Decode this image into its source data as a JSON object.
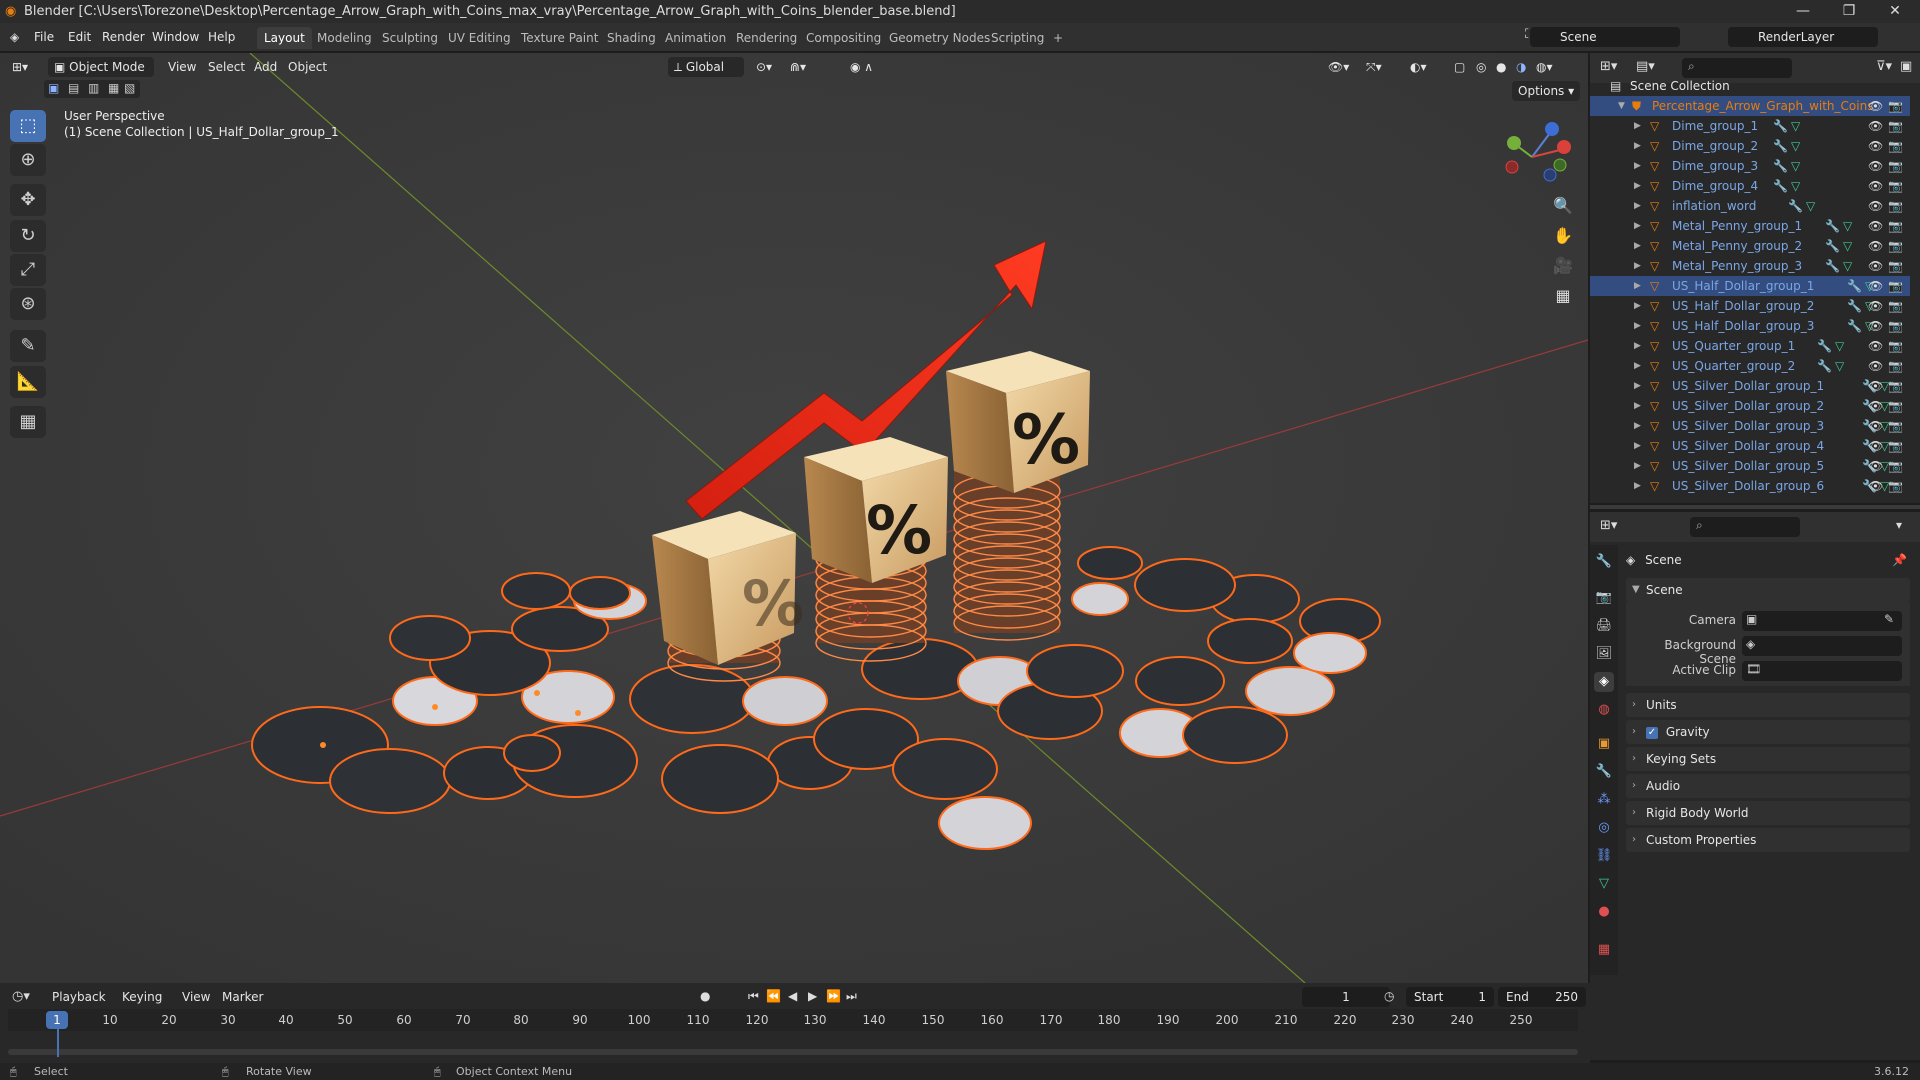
{
  "window": {
    "title": "Blender [C:\\Users\\Torezone\\Desktop\\Percentage_Arrow_Graph_with_Coins_max_vray\\Percentage_Arrow_Graph_with_Coins_blender_base.blend]"
  },
  "menu": [
    "File",
    "Edit",
    "Render",
    "Window",
    "Help"
  ],
  "workspaces": [
    "Layout",
    "Modeling",
    "Sculpting",
    "UV Editing",
    "Texture Paint",
    "Shading",
    "Animation",
    "Rendering",
    "Compositing",
    "Geometry Nodes",
    "Scripting",
    "+"
  ],
  "active_workspace": "Layout",
  "scene_field": "Scene",
  "renderlayer_field": "RenderLayer",
  "viewport": {
    "mode": "Object Mode",
    "menus": [
      "View",
      "Select",
      "Add",
      "Object"
    ],
    "orientation": "Global",
    "options": "Options",
    "overlay_title": "User Perspective",
    "overlay_context": "(1) Scene Collection | US_Half_Dollar_group_1",
    "gizmo": {
      "x": "X",
      "y": "Y",
      "z": "Z"
    }
  },
  "outliner": {
    "root": "Scene Collection",
    "collection": "Percentage_Arrow_Graph_with_Coins",
    "items": [
      "Dime_group_1",
      "Dime_group_2",
      "Dime_group_3",
      "Dime_group_4",
      "inflation_word",
      "Metal_Penny_group_1",
      "Metal_Penny_group_2",
      "Metal_Penny_group_3",
      "US_Half_Dollar_group_1",
      "US_Half_Dollar_group_2",
      "US_Half_Dollar_group_3",
      "US_Quarter_group_1",
      "US_Quarter_group_2",
      "US_Silver_Dollar_group_1",
      "US_Silver_Dollar_group_2",
      "US_Silver_Dollar_group_3",
      "US_Silver_Dollar_group_4",
      "US_Silver_Dollar_group_5",
      "US_Silver_Dollar_group_6"
    ],
    "selected": "US_Half_Dollar_group_1"
  },
  "properties": {
    "header": "Scene",
    "section": "Scene",
    "labels": {
      "camera": "Camera",
      "background_scene": "Background Scene",
      "active_clip": "Active Clip"
    },
    "panels": [
      "Units",
      "Gravity",
      "Keying Sets",
      "Audio",
      "Rigid Body World",
      "Custom Properties"
    ],
    "gravity_checked": true
  },
  "timeline": {
    "menus": [
      "Playback",
      "Keying",
      "View",
      "Marker"
    ],
    "current_frame": "1",
    "start_label": "Start",
    "start": "1",
    "end_label": "End",
    "end": "250",
    "ticks": [
      "1",
      "10",
      "20",
      "30",
      "40",
      "50",
      "60",
      "70",
      "80",
      "90",
      "100",
      "110",
      "120",
      "130",
      "140",
      "150",
      "160",
      "170",
      "180",
      "190",
      "200",
      "210",
      "220",
      "230",
      "240",
      "250"
    ]
  },
  "status": {
    "select": "Select",
    "rotate": "Rotate View",
    "context": "Object Context Menu",
    "version": "3.6.12"
  },
  "colors": {
    "accent": "#4772b3",
    "selection": "#e87d0d",
    "viewport_bg": "#3a3a3a"
  }
}
